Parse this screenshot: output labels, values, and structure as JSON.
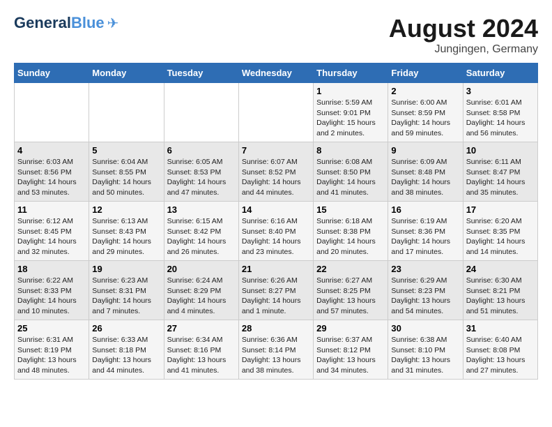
{
  "header": {
    "logo_general": "General",
    "logo_blue": "Blue",
    "month_year": "August 2024",
    "location": "Jungingen, Germany"
  },
  "days_of_week": [
    "Sunday",
    "Monday",
    "Tuesday",
    "Wednesday",
    "Thursday",
    "Friday",
    "Saturday"
  ],
  "weeks": [
    [
      {
        "day": "",
        "info": ""
      },
      {
        "day": "",
        "info": ""
      },
      {
        "day": "",
        "info": ""
      },
      {
        "day": "",
        "info": ""
      },
      {
        "day": "1",
        "sunrise": "Sunrise: 5:59 AM",
        "sunset": "Sunset: 9:01 PM",
        "daylight": "Daylight: 15 hours and 2 minutes."
      },
      {
        "day": "2",
        "sunrise": "Sunrise: 6:00 AM",
        "sunset": "Sunset: 8:59 PM",
        "daylight": "Daylight: 14 hours and 59 minutes."
      },
      {
        "day": "3",
        "sunrise": "Sunrise: 6:01 AM",
        "sunset": "Sunset: 8:58 PM",
        "daylight": "Daylight: 14 hours and 56 minutes."
      }
    ],
    [
      {
        "day": "4",
        "sunrise": "Sunrise: 6:03 AM",
        "sunset": "Sunset: 8:56 PM",
        "daylight": "Daylight: 14 hours and 53 minutes."
      },
      {
        "day": "5",
        "sunrise": "Sunrise: 6:04 AM",
        "sunset": "Sunset: 8:55 PM",
        "daylight": "Daylight: 14 hours and 50 minutes."
      },
      {
        "day": "6",
        "sunrise": "Sunrise: 6:05 AM",
        "sunset": "Sunset: 8:53 PM",
        "daylight": "Daylight: 14 hours and 47 minutes."
      },
      {
        "day": "7",
        "sunrise": "Sunrise: 6:07 AM",
        "sunset": "Sunset: 8:52 PM",
        "daylight": "Daylight: 14 hours and 44 minutes."
      },
      {
        "day": "8",
        "sunrise": "Sunrise: 6:08 AM",
        "sunset": "Sunset: 8:50 PM",
        "daylight": "Daylight: 14 hours and 41 minutes."
      },
      {
        "day": "9",
        "sunrise": "Sunrise: 6:09 AM",
        "sunset": "Sunset: 8:48 PM",
        "daylight": "Daylight: 14 hours and 38 minutes."
      },
      {
        "day": "10",
        "sunrise": "Sunrise: 6:11 AM",
        "sunset": "Sunset: 8:47 PM",
        "daylight": "Daylight: 14 hours and 35 minutes."
      }
    ],
    [
      {
        "day": "11",
        "sunrise": "Sunrise: 6:12 AM",
        "sunset": "Sunset: 8:45 PM",
        "daylight": "Daylight: 14 hours and 32 minutes."
      },
      {
        "day": "12",
        "sunrise": "Sunrise: 6:13 AM",
        "sunset": "Sunset: 8:43 PM",
        "daylight": "Daylight: 14 hours and 29 minutes."
      },
      {
        "day": "13",
        "sunrise": "Sunrise: 6:15 AM",
        "sunset": "Sunset: 8:42 PM",
        "daylight": "Daylight: 14 hours and 26 minutes."
      },
      {
        "day": "14",
        "sunrise": "Sunrise: 6:16 AM",
        "sunset": "Sunset: 8:40 PM",
        "daylight": "Daylight: 14 hours and 23 minutes."
      },
      {
        "day": "15",
        "sunrise": "Sunrise: 6:18 AM",
        "sunset": "Sunset: 8:38 PM",
        "daylight": "Daylight: 14 hours and 20 minutes."
      },
      {
        "day": "16",
        "sunrise": "Sunrise: 6:19 AM",
        "sunset": "Sunset: 8:36 PM",
        "daylight": "Daylight: 14 hours and 17 minutes."
      },
      {
        "day": "17",
        "sunrise": "Sunrise: 6:20 AM",
        "sunset": "Sunset: 8:35 PM",
        "daylight": "Daylight: 14 hours and 14 minutes."
      }
    ],
    [
      {
        "day": "18",
        "sunrise": "Sunrise: 6:22 AM",
        "sunset": "Sunset: 8:33 PM",
        "daylight": "Daylight: 14 hours and 10 minutes."
      },
      {
        "day": "19",
        "sunrise": "Sunrise: 6:23 AM",
        "sunset": "Sunset: 8:31 PM",
        "daylight": "Daylight: 14 hours and 7 minutes."
      },
      {
        "day": "20",
        "sunrise": "Sunrise: 6:24 AM",
        "sunset": "Sunset: 8:29 PM",
        "daylight": "Daylight: 14 hours and 4 minutes."
      },
      {
        "day": "21",
        "sunrise": "Sunrise: 6:26 AM",
        "sunset": "Sunset: 8:27 PM",
        "daylight": "Daylight: 14 hours and 1 minute."
      },
      {
        "day": "22",
        "sunrise": "Sunrise: 6:27 AM",
        "sunset": "Sunset: 8:25 PM",
        "daylight": "Daylight: 13 hours and 57 minutes."
      },
      {
        "day": "23",
        "sunrise": "Sunrise: 6:29 AM",
        "sunset": "Sunset: 8:23 PM",
        "daylight": "Daylight: 13 hours and 54 minutes."
      },
      {
        "day": "24",
        "sunrise": "Sunrise: 6:30 AM",
        "sunset": "Sunset: 8:21 PM",
        "daylight": "Daylight: 13 hours and 51 minutes."
      }
    ],
    [
      {
        "day": "25",
        "sunrise": "Sunrise: 6:31 AM",
        "sunset": "Sunset: 8:19 PM",
        "daylight": "Daylight: 13 hours and 48 minutes."
      },
      {
        "day": "26",
        "sunrise": "Sunrise: 6:33 AM",
        "sunset": "Sunset: 8:18 PM",
        "daylight": "Daylight: 13 hours and 44 minutes."
      },
      {
        "day": "27",
        "sunrise": "Sunrise: 6:34 AM",
        "sunset": "Sunset: 8:16 PM",
        "daylight": "Daylight: 13 hours and 41 minutes."
      },
      {
        "day": "28",
        "sunrise": "Sunrise: 6:36 AM",
        "sunset": "Sunset: 8:14 PM",
        "daylight": "Daylight: 13 hours and 38 minutes."
      },
      {
        "day": "29",
        "sunrise": "Sunrise: 6:37 AM",
        "sunset": "Sunset: 8:12 PM",
        "daylight": "Daylight: 13 hours and 34 minutes."
      },
      {
        "day": "30",
        "sunrise": "Sunrise: 6:38 AM",
        "sunset": "Sunset: 8:10 PM",
        "daylight": "Daylight: 13 hours and 31 minutes."
      },
      {
        "day": "31",
        "sunrise": "Sunrise: 6:40 AM",
        "sunset": "Sunset: 8:08 PM",
        "daylight": "Daylight: 13 hours and 27 minutes."
      }
    ]
  ]
}
